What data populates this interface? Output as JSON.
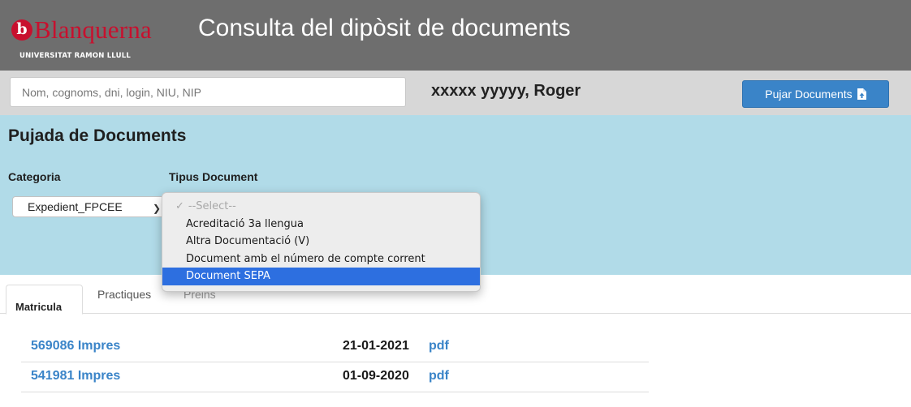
{
  "header": {
    "logo_mark": "b",
    "logo_word": "Blanquerna",
    "logo_subtitle": "UNIVERSITAT RAMON LLULL",
    "title": "Consulta del dipòsit de documents"
  },
  "userbar": {
    "search_placeholder": "Nom, cognoms, dni, login, NIU, NIP",
    "user_name": "xxxxx yyyyy, Roger",
    "upload_button_label": "Pujar Documents",
    "upload_icon": "file-upload-icon"
  },
  "upload_panel": {
    "title": "Pujada de Documents",
    "category_label": "Categoria",
    "category_value": "Expedient_FPCEE",
    "doc_type_label": "Tipus Document",
    "doc_type_options": [
      "--Select--",
      "Acreditació 3a llengua",
      "Altra Documentació (V)",
      "Document amb el número de compte corrent",
      "Document SEPA"
    ],
    "highlighted_option": "Document SEPA"
  },
  "tabs": [
    {
      "label": "Matricula",
      "active": true
    },
    {
      "label": "Practiques",
      "active": false
    },
    {
      "label": "Preins",
      "active": false
    }
  ],
  "documents": [
    {
      "name": "569086 Impres",
      "date": "21-01-2021",
      "format": "pdf"
    },
    {
      "name": "541981 Impres",
      "date": "01-09-2020",
      "format": "pdf"
    }
  ],
  "colors": {
    "header_bg": "#6e6e6e",
    "brand_red": "#c8102e",
    "panel_bg": "#b1dbe8",
    "link_blue": "#3a84c8",
    "highlight_blue": "#2d6fe0"
  }
}
